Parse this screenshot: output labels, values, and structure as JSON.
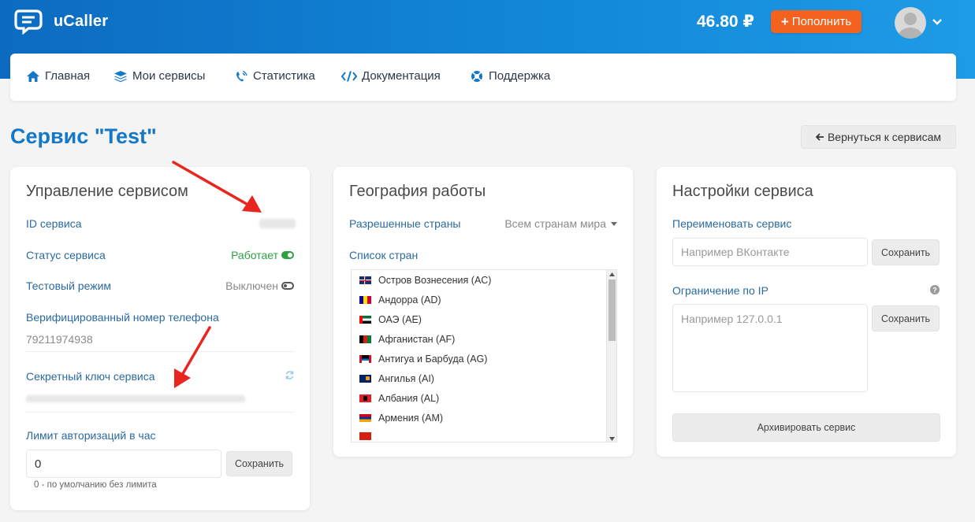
{
  "header": {
    "brand": "uCaller",
    "balance": "46.80 ₽",
    "topup_label": "Пополнить",
    "colors": {
      "accent": "#f4621f",
      "brand_blue": "#1578c6"
    }
  },
  "nav": {
    "items": [
      {
        "label": "Главная",
        "icon": "home-icon"
      },
      {
        "label": "Мои сервисы",
        "icon": "layers-icon"
      },
      {
        "label": "Статистика",
        "icon": "phone-icon"
      },
      {
        "label": "Документация",
        "icon": "code-icon"
      },
      {
        "label": "Поддержка",
        "icon": "lifebuoy-icon"
      }
    ]
  },
  "page": {
    "title": "Сервис \"Test\"",
    "back_label": "Вернуться к сервисам"
  },
  "management": {
    "title": "Управление сервисом",
    "service_id_label": "ID сервиса",
    "status_label": "Статус сервиса",
    "status_value": "Работает",
    "test_mode_label": "Тестовый режим",
    "test_mode_value": "Выключен",
    "verified_phone_label": "Верифицированный номер телефона",
    "verified_phone_value": "79211974938",
    "secret_key_label": "Секретный ключ сервиса",
    "limit_label": "Лимит авторизаций в час",
    "limit_value": "0",
    "limit_save": "Сохранить",
    "limit_hint": "0 - по умолчанию без лимита"
  },
  "geography": {
    "title": "География работы",
    "allowed_label": "Разрешенные страны",
    "allowed_value": "Всем странам мира",
    "list_label": "Список стран",
    "countries": [
      "Остров Вознесения (AC)",
      "Андорра (AD)",
      "ОАЭ (AE)",
      "Афганистан (AF)",
      "Антигуа и Барбуда (AG)",
      "Ангилья (AI)",
      "Албания (AL)",
      "Армения (AM)"
    ]
  },
  "settings": {
    "title": "Настройки сервиса",
    "rename_label": "Переименовать сервис",
    "rename_placeholder": "Например ВКонтакте",
    "rename_save": "Сохранить",
    "ip_label": "Ограничение по IP",
    "ip_placeholder": "Например 127.0.0.1",
    "ip_save": "Сохранить",
    "archive_label": "Архивировать сервис"
  }
}
